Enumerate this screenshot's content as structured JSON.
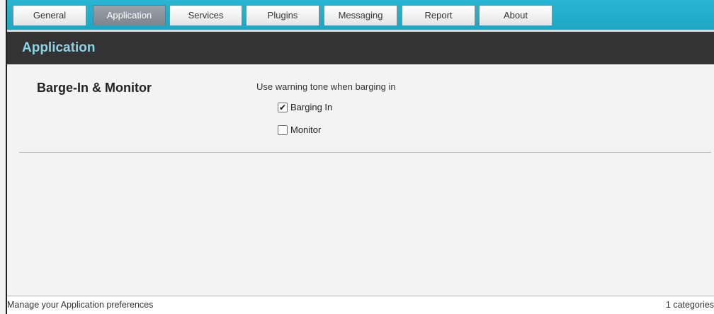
{
  "tabs": [
    {
      "label": "General",
      "active": false
    },
    {
      "label": "Application",
      "active": true
    },
    {
      "label": "Services",
      "active": false
    },
    {
      "label": "Plugins",
      "active": false
    },
    {
      "label": "Messaging",
      "active": false
    },
    {
      "label": "Report",
      "active": false
    },
    {
      "label": "About",
      "active": false
    }
  ],
  "header": {
    "title": "Application"
  },
  "section": {
    "title": "Barge-In & Monitor",
    "description": "Use warning tone when barging in",
    "options": [
      {
        "label": "Barging In",
        "checked": true
      },
      {
        "label": "Monitor",
        "checked": false
      }
    ]
  },
  "status": {
    "left": "Manage your Application preferences",
    "right": "1 categories"
  },
  "colors": {
    "tabbar": "#1ea5c2",
    "header_bg": "#333333",
    "header_text": "#8ed3e6",
    "active_tab": "#7d848b"
  },
  "icons": {
    "check": "check-icon"
  }
}
